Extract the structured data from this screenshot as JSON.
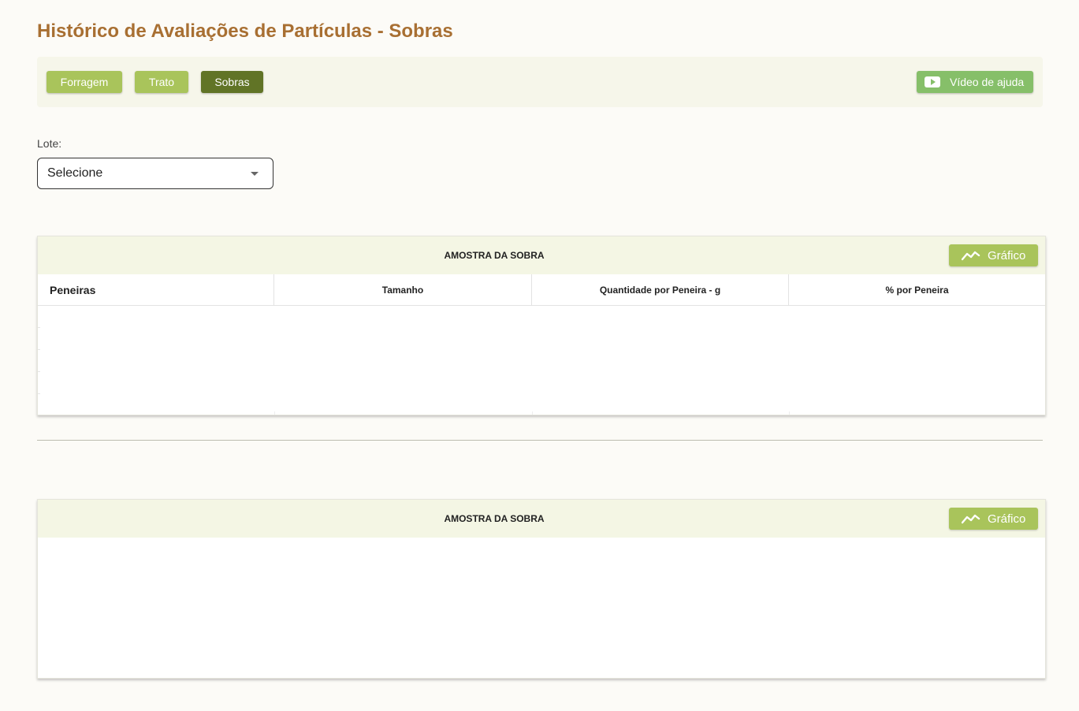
{
  "page": {
    "title": "Histórico de Avaliações de Partículas - Sobras"
  },
  "tabs": [
    {
      "label": "Forragem",
      "state": "inactive"
    },
    {
      "label": "Trato",
      "state": "inactive"
    },
    {
      "label": "Sobras",
      "state": "active"
    }
  ],
  "help": {
    "label": "Vídeo de ajuda",
    "icon": "video-play-icon"
  },
  "lote": {
    "label": "Lote:",
    "selected": "Selecione"
  },
  "cards": [
    {
      "title": "AMOSTRA DA SOBRA",
      "chart_button": "Gráfico",
      "columns": [
        "Peneiras",
        "Tamanho",
        "Quantidade por Peneira - g",
        "% por  Peneira"
      ],
      "rows": []
    },
    {
      "title": "AMOSTRA DA SOBRA",
      "chart_button": "Gráfico",
      "rows": []
    }
  ],
  "colors": {
    "title": "#a86f32",
    "tab_inactive": "#a9c45b",
    "tab_active": "#617426",
    "help_button": "#86bf69",
    "card_header": "#f4f6e4"
  }
}
